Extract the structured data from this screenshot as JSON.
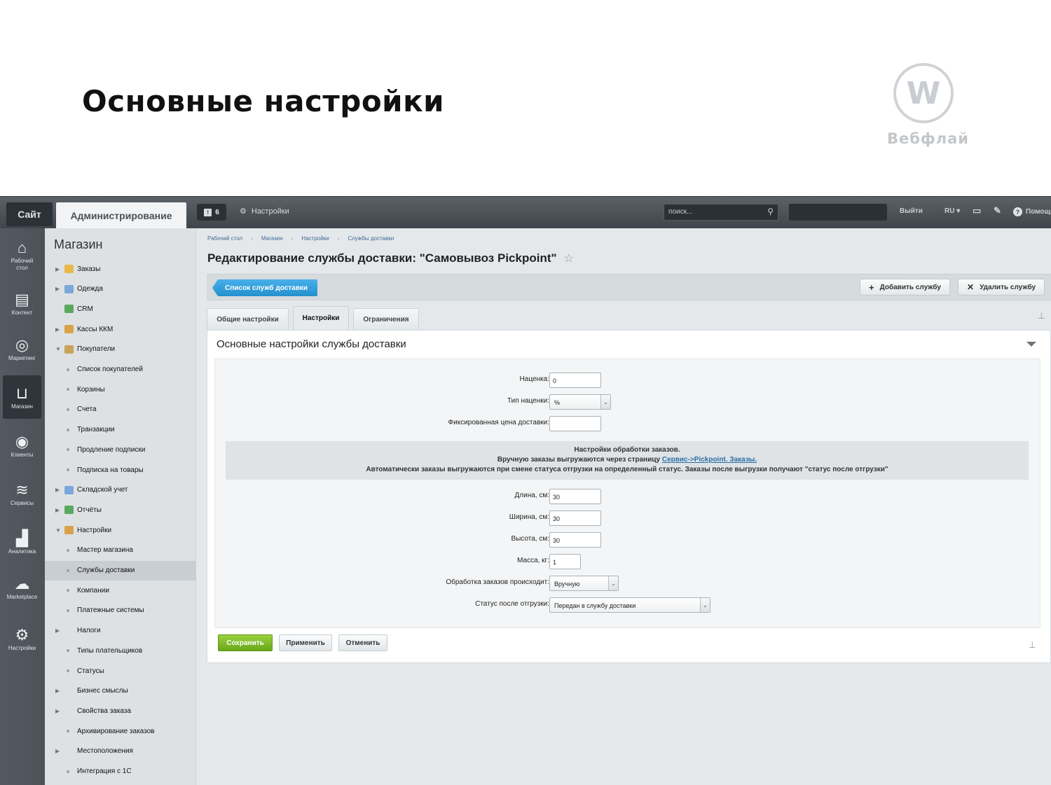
{
  "slide": {
    "title": "Основные настройки",
    "logo_letter": "W",
    "logo_text": "Вебфлай"
  },
  "topbar": {
    "site": "Сайт",
    "admin": "Администрирование",
    "notifications": "6",
    "settings": "Настройки",
    "search_placeholder": "поиск...",
    "logout": "Выйти",
    "lang": "RU",
    "help": "Помощь"
  },
  "leftnav": [
    {
      "label": "Рабочий стол",
      "icon": "home-icon"
    },
    {
      "label": "Контент",
      "icon": "document-icon"
    },
    {
      "label": "Маркетинг",
      "icon": "target-icon"
    },
    {
      "label": "Магазин",
      "icon": "basket-icon"
    },
    {
      "label": "Клиенты",
      "icon": "clients-24-icon"
    },
    {
      "label": "Сервисы",
      "icon": "layers-icon"
    },
    {
      "label": "Аналитика",
      "icon": "bar-chart-icon"
    },
    {
      "label": "Marketplace",
      "icon": "cloud-download-icon"
    },
    {
      "label": "Настройки",
      "icon": "gear-icon"
    }
  ],
  "sidebar": {
    "title": "Магазин",
    "items": [
      {
        "label": "Заказы",
        "type": "folder"
      },
      {
        "label": "Одежда",
        "type": "folder"
      },
      {
        "label": "CRM",
        "type": "leaf-icon"
      },
      {
        "label": "Кассы ККМ",
        "type": "folder"
      },
      {
        "label": "Покупатели",
        "type": "open"
      },
      {
        "label": "Список покупателей",
        "type": "child"
      },
      {
        "label": "Корзины",
        "type": "child"
      },
      {
        "label": "Счета",
        "type": "child"
      },
      {
        "label": "Транзакции",
        "type": "child"
      },
      {
        "label": "Продление подписки",
        "type": "child"
      },
      {
        "label": "Подписка на товары",
        "type": "child"
      },
      {
        "label": "Складской учет",
        "type": "folder"
      },
      {
        "label": "Отчёты",
        "type": "folder"
      },
      {
        "label": "Настройки",
        "type": "open"
      },
      {
        "label": "Мастер магазина",
        "type": "child"
      },
      {
        "label": "Службы доставки",
        "type": "child-active"
      },
      {
        "label": "Компании",
        "type": "child"
      },
      {
        "label": "Платежные системы",
        "type": "child"
      },
      {
        "label": "Налоги",
        "type": "child-arrow"
      },
      {
        "label": "Типы плательщиков",
        "type": "child"
      },
      {
        "label": "Статусы",
        "type": "child"
      },
      {
        "label": "Бизнес смыслы",
        "type": "child-arrow"
      },
      {
        "label": "Свойства заказа",
        "type": "child-arrow"
      },
      {
        "label": "Архивирование заказов",
        "type": "child"
      },
      {
        "label": "Местоположения",
        "type": "child-arrow"
      },
      {
        "label": "Интеграция с 1С",
        "type": "child"
      }
    ]
  },
  "breadcrumbs": [
    "Рабочий стол",
    "Магазин",
    "Настройки",
    "Службы доставки"
  ],
  "page_title": "Редактирование службы доставки: \"Самовывоз Pickpoint\"",
  "toolbar": {
    "list": "Список служб доставки",
    "add": "Добавить службу",
    "delete": "Удалить службу"
  },
  "tabs": [
    "Общие настройки",
    "Настройки",
    "Ограничения"
  ],
  "active_tab": "Настройки",
  "panel": {
    "title": "Основные настройки службы доставки",
    "fields": {
      "markup": {
        "label": "Наценка:",
        "value": "0"
      },
      "markup_type": {
        "label": "Тип наценки:",
        "value": "%"
      },
      "fixed_price": {
        "label": "Фиксированная цена доставки:",
        "value": ""
      },
      "length": {
        "label": "Длина, см:",
        "value": "30"
      },
      "width": {
        "label": "Ширина, см:",
        "value": "30"
      },
      "height": {
        "label": "Высота, см:",
        "value": "30"
      },
      "mass": {
        "label": "Масса, кг:",
        "value": "1"
      },
      "processing": {
        "label": "Обработка заказов происходит:",
        "value": "Вручную"
      },
      "status_after": {
        "label": "Статус после отгрузки:",
        "value": "Передан в службу доставки"
      }
    },
    "note": {
      "line1": "Настройки обработки заказов.",
      "line2_prefix": "Вручную заказы выгружаются через страницу ",
      "line2_link": "Сервис->Pickpoint. Заказы.",
      "line3": "Автоматически заказы выгружаются при смене статуса отгрузки на определенный статус. Заказы после выгрузки получают \"статус после отгрузки\""
    }
  },
  "actions": {
    "save": "Сохранить",
    "apply": "Применить",
    "cancel": "Отменить"
  },
  "colors": {
    "primary_blue": "#2390cd",
    "save_green": "#6aa61a",
    "topbar": "#3f454b"
  }
}
